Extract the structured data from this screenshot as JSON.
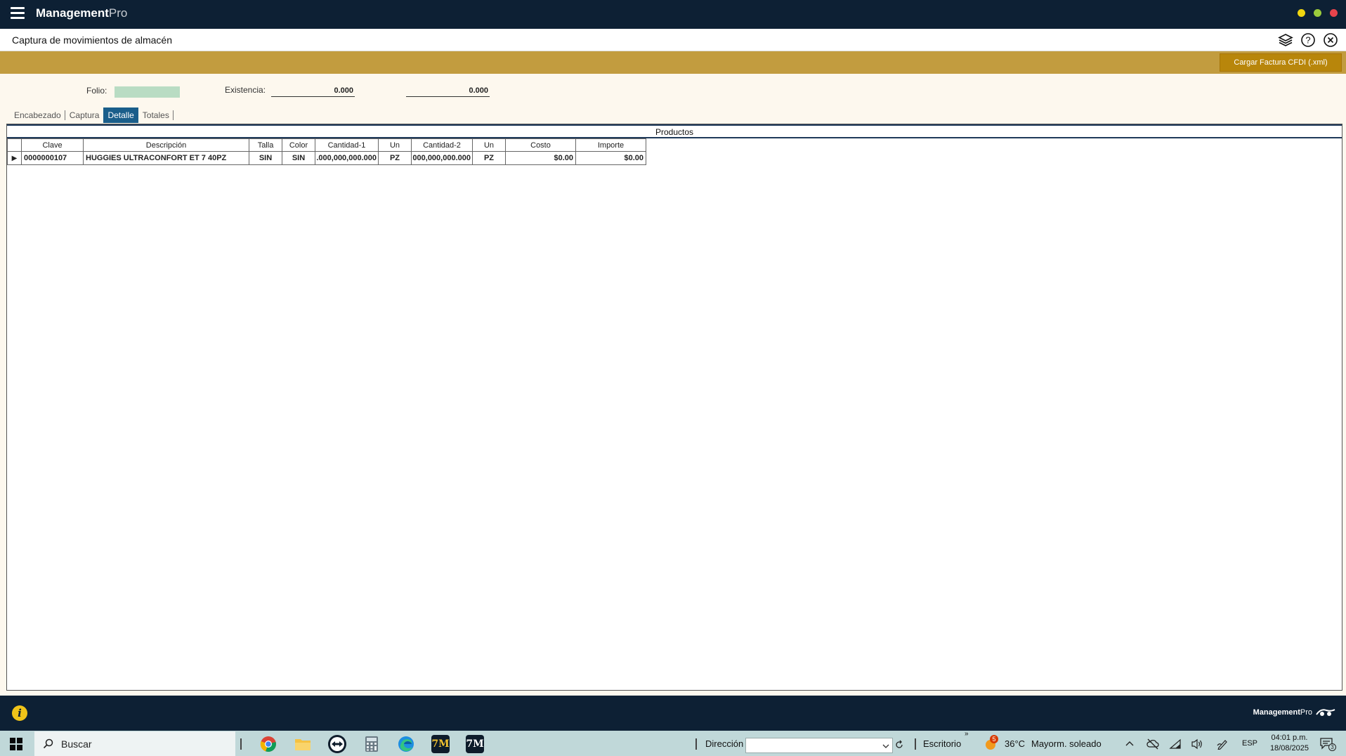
{
  "app": {
    "brand_bold": "Management",
    "brand_light": "Pro",
    "window_dots": [
      "#f1d60f",
      "#9ccc3c",
      "#e9444c"
    ]
  },
  "header": {
    "title": "Captura de movimientos de almacén"
  },
  "toolbar": {
    "cfdi_button": "Cargar Factura CFDI (.xml)"
  },
  "form": {
    "folio_label": "Folio:",
    "folio_value": "",
    "existencia_label": "Existencia:",
    "existencia_1": "0.000",
    "existencia_2": "0.000"
  },
  "tabs": [
    {
      "label": "Encabezado",
      "active": false
    },
    {
      "label": "Captura",
      "active": false
    },
    {
      "label": "Detalle",
      "active": true
    },
    {
      "label": "Totales",
      "active": false
    }
  ],
  "products": {
    "title": "Productos",
    "columns": [
      "Clave",
      "Descripción",
      "Talla",
      "Color",
      "Cantidad-1",
      "Un",
      "Cantidad-2",
      "Un",
      "Costo",
      "Importe"
    ],
    "rows": [
      [
        "0000000107",
        "HUGGIES ULTRACONFORT ET 7 40PZ",
        "SIN",
        "SIN",
        ".000,000,000.000",
        "PZ",
        "000,000,000.000",
        "PZ",
        "$0.00",
        "$0.00"
      ]
    ]
  },
  "footer": {
    "brand_bold": "Management",
    "brand_light": "Pro"
  },
  "taskbar": {
    "search_label": "Buscar",
    "apps": [
      "chrome-icon",
      "file-explorer-icon",
      "teamviewer-icon",
      "calculator-icon",
      "edge-icon",
      "managementpro-icon",
      "managementpro-icon"
    ],
    "address_label": "Dirección",
    "address_value": "",
    "desktop_label": "Escritorio",
    "weather_badge": "5",
    "weather_temp": "36°C",
    "weather_desc": "Mayorm. soleado",
    "language": "ESP",
    "time": "04:01 p.m.",
    "date": "18/08/2025",
    "notification_count": "3"
  }
}
